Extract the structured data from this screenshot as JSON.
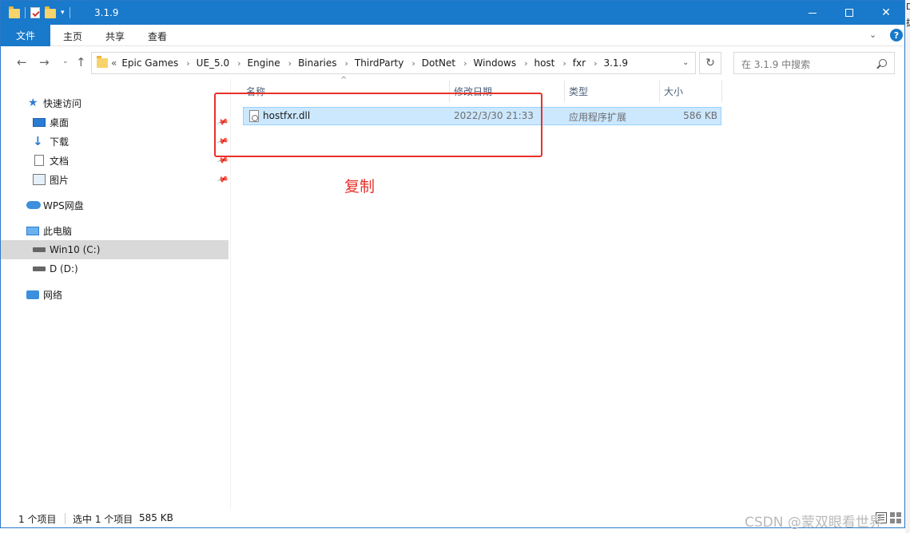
{
  "titlebar": {
    "title": "3.1.9",
    "qat_dropdown": "▾",
    "minimize_label": "",
    "close_label": "✕"
  },
  "ribbon": {
    "tabs": [
      "文件",
      "主页",
      "共享",
      "查看"
    ],
    "expand": "⌄",
    "help": "?"
  },
  "nav": {
    "back": "←",
    "forward": "→",
    "recent": "⌄",
    "up": "↑",
    "crumb_lead": "«",
    "breadcrumb": [
      "Epic Games",
      "UE_5.0",
      "Engine",
      "Binaries",
      "ThirdParty",
      "DotNet",
      "Windows",
      "host",
      "fxr",
      "3.1.9"
    ],
    "chevron": "›",
    "dropdown": "⌄",
    "refresh": "↻",
    "search_placeholder": "在 3.1.9 中搜索"
  },
  "sidebar": {
    "items": [
      {
        "label": "快速访问",
        "icon": "star-icon"
      },
      {
        "label": "桌面",
        "icon": "desktop-icon",
        "pinned": true
      },
      {
        "label": "下载",
        "icon": "download-icon",
        "pinned": true
      },
      {
        "label": "文档",
        "icon": "document-icon",
        "pinned": true
      },
      {
        "label": "图片",
        "icon": "pictures-icon",
        "pinned": true
      },
      {
        "label": "WPS网盘",
        "icon": "cloud-icon"
      },
      {
        "label": "此电脑",
        "icon": "computer-icon"
      },
      {
        "label": "Win10 (C:)",
        "icon": "drive-icon",
        "selected": true
      },
      {
        "label": "D (D:)",
        "icon": "drive-icon"
      },
      {
        "label": "网络",
        "icon": "network-icon"
      }
    ],
    "pin_glyph": "📌"
  },
  "columns": {
    "sort_caret": "^",
    "name": "名称",
    "date": "修改日期",
    "type": "类型",
    "size": "大小"
  },
  "files": [
    {
      "name": "hostfxr.dll",
      "date": "2022/3/30 21:33",
      "type": "应用程序扩展",
      "size": "586 KB",
      "selected": true
    }
  ],
  "annotation": {
    "text": "复制",
    "color": "#e8312a"
  },
  "status": {
    "count": "1 个项目",
    "selected": "选中 1 个项目",
    "selected_size": "585 KB"
  },
  "watermark": "CSDN @蒙双眼看世界",
  "edge_glyphs": [
    "D",
    "拔"
  ],
  "colors": {
    "titlebar": "#1979ca",
    "selection": "#cce8ff",
    "selection_border": "#99d1ff"
  }
}
